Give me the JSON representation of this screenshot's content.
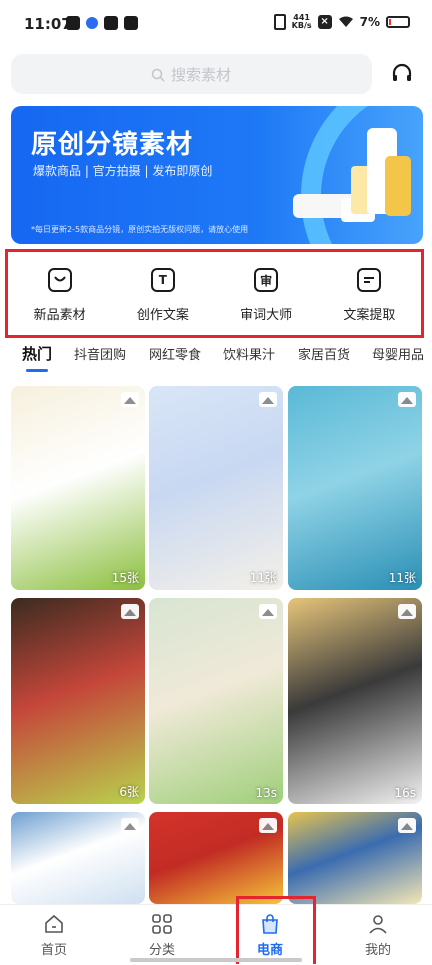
{
  "status_bar": {
    "time": "11:07",
    "net_speed": "441",
    "net_unit": "KB/s",
    "battery": "7%"
  },
  "search": {
    "placeholder": "搜索素材"
  },
  "banner": {
    "title": "原创分镜素材",
    "subtitle": "爆款商品 | 官方拍摄 | 发布即原创",
    "note": "*每日更新2-5款商品分镜，原创实拍无版权问题，请放心使用"
  },
  "tools": [
    {
      "label": "新品素材",
      "icon": "bag-icon"
    },
    {
      "label": "创作文案",
      "icon": "text-icon"
    },
    {
      "label": "审词大师",
      "icon": "review-icon"
    },
    {
      "label": "文案提取",
      "icon": "extract-icon"
    }
  ],
  "categories": [
    "热门",
    "抖音团购",
    "网红零食",
    "饮料果汁",
    "家居百货",
    "母婴用品"
  ],
  "active_category": "热门",
  "grid": [
    {
      "count": "15张",
      "colors": [
        "#f6f0dc",
        "#8bbf3e",
        "#ffffff"
      ]
    },
    {
      "count": "11张",
      "colors": [
        "#d9e6f7",
        "#f4f0e8",
        "#c8d8f2"
      ]
    },
    {
      "count": "11张",
      "colors": [
        "#59b9d6",
        "#2a8fb5",
        "#8fd3e6"
      ]
    },
    {
      "count": "6张",
      "colors": [
        "#3b2b20",
        "#b9d34d",
        "#c4463a"
      ]
    },
    {
      "count": "13s",
      "colors": [
        "#d7e5d2",
        "#9fcf7a",
        "#f0e9d8"
      ]
    },
    {
      "count": "16s",
      "colors": [
        "#e7c57a",
        "#f2f2f2",
        "#3a3a3a"
      ]
    },
    {
      "count": "",
      "colors": [
        "#6e9fd0",
        "#cfe0f0",
        "#ffffff"
      ]
    },
    {
      "count": "",
      "colors": [
        "#d4332b",
        "#f4c43a",
        "#c22c24"
      ]
    },
    {
      "count": "",
      "colors": [
        "#e7c44f",
        "#f4e7b4",
        "#3b6cb0"
      ]
    }
  ],
  "bottom_nav": [
    {
      "label": "首页",
      "icon": "home-icon"
    },
    {
      "label": "分类",
      "icon": "category-icon"
    },
    {
      "label": "电商",
      "icon": "shopping-bag-icon"
    },
    {
      "label": "我的",
      "icon": "profile-icon"
    }
  ]
}
